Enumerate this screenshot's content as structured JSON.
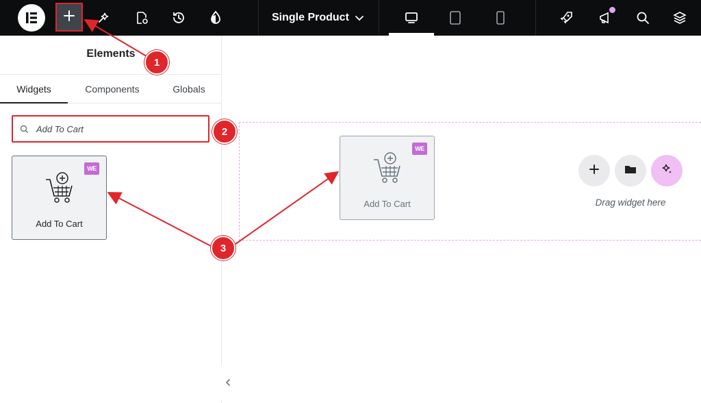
{
  "topbar": {
    "document_title": "Single Product",
    "icons": [
      "elementor-logo-icon",
      "plus-icon",
      "ai-sparkle-icon",
      "page-settings-icon",
      "history-icon",
      "site-settings-icon",
      "chevron-down-icon",
      "desktop-icon",
      "tablet-icon",
      "mobile-icon",
      "rocket-icon",
      "megaphone-icon",
      "search-icon",
      "layers-icon"
    ],
    "notification_dot_color": "#e3a3f0"
  },
  "panel": {
    "title": "Elements",
    "tabs": [
      {
        "label": "Widgets",
        "active": true
      },
      {
        "label": "Components",
        "active": false
      },
      {
        "label": "Globals",
        "active": false
      }
    ],
    "search": {
      "value": "Add To Cart"
    },
    "widget": {
      "label": "Add To Cart",
      "badge": "WE"
    }
  },
  "canvas": {
    "dragged_widget": {
      "label": "Add To Cart",
      "badge": "WE"
    },
    "drag_hint": "Drag widget here",
    "drop_zone_color": "#e5a8e8"
  },
  "annotations": {
    "markers": [
      "1",
      "2",
      "3"
    ],
    "color": "#e0252b"
  }
}
